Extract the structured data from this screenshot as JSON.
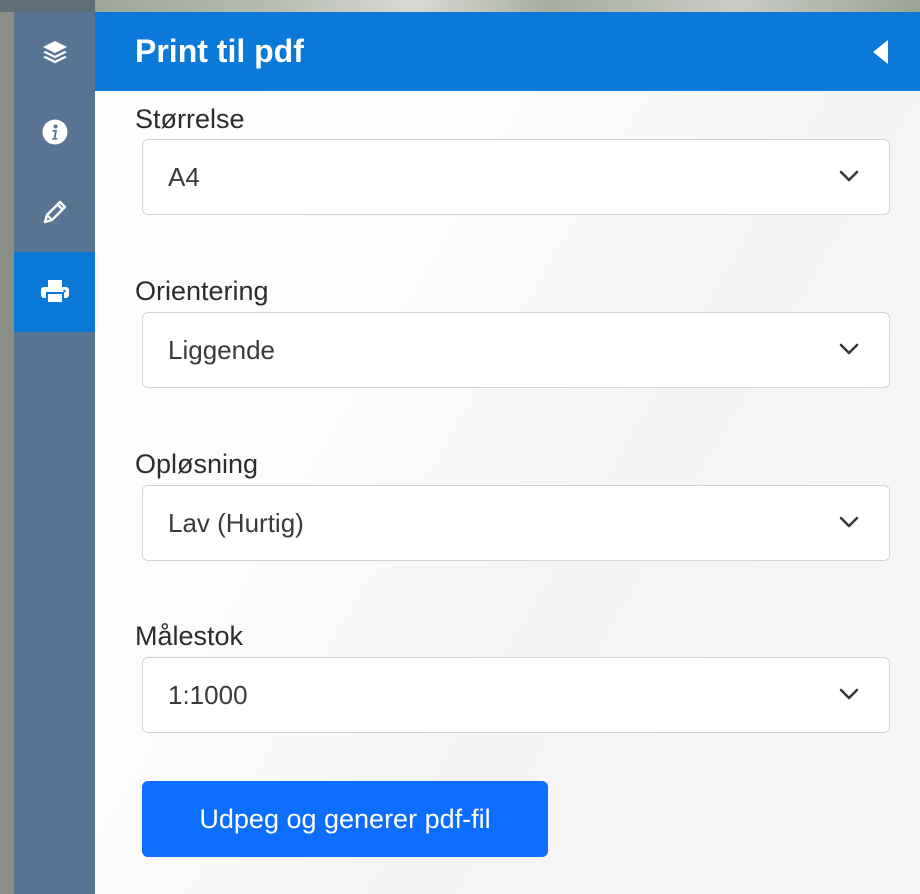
{
  "sidebar": {
    "items": [
      {
        "icon": "layers-icon",
        "active": false
      },
      {
        "icon": "info-icon",
        "active": false
      },
      {
        "icon": "pencil-icon",
        "active": false
      },
      {
        "icon": "printer-icon",
        "active": true
      }
    ]
  },
  "panel": {
    "title": "Print til pdf"
  },
  "fields": [
    {
      "label": "Størrelse",
      "value": "A4"
    },
    {
      "label": "Orientering",
      "value": "Liggende"
    },
    {
      "label": "Opløsning",
      "value": "Lav (Hurtig)"
    },
    {
      "label": "Målestok",
      "value": "1:1000"
    }
  ],
  "action": {
    "label": "Udpeg og generer pdf-fil"
  },
  "colors": {
    "accent": "#0a79d7",
    "button": "#0d6efd",
    "sidebar": "#597393"
  }
}
